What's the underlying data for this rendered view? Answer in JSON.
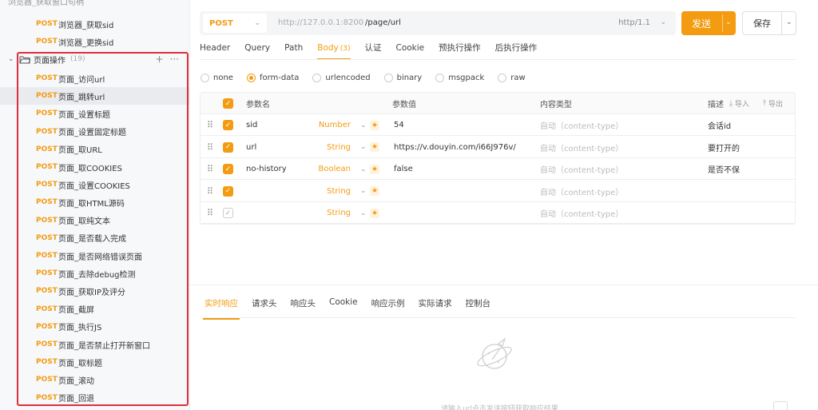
{
  "sidebar": {
    "top_cut_text": "浏览器_获取窗口句柄",
    "pre_items": [
      {
        "method": "POST",
        "name": "浏览器_获取sid"
      },
      {
        "method": "POST",
        "name": "浏览器_更换sid"
      }
    ],
    "folder": {
      "label": "页面操作",
      "count": "(19)",
      "add": "+",
      "more": "···"
    },
    "items": [
      {
        "method": "POST",
        "name": "页面_访问url"
      },
      {
        "method": "POST",
        "name": "页面_跳转url"
      },
      {
        "method": "POST",
        "name": "页面_设置标题"
      },
      {
        "method": "POST",
        "name": "页面_设置固定标题"
      },
      {
        "method": "POST",
        "name": "页面_取URL"
      },
      {
        "method": "POST",
        "name": "页面_取COOKIES"
      },
      {
        "method": "POST",
        "name": "页面_设置COOKIES"
      },
      {
        "method": "POST",
        "name": "页面_取HTML源码"
      },
      {
        "method": "POST",
        "name": "页面_取纯文本"
      },
      {
        "method": "POST",
        "name": "页面_是否载入完成"
      },
      {
        "method": "POST",
        "name": "页面_是否网络错误页面"
      },
      {
        "method": "POST",
        "name": "页面_去除debug检测"
      },
      {
        "method": "POST",
        "name": "页面_获取IP及评分"
      },
      {
        "method": "POST",
        "name": "页面_截屏"
      },
      {
        "method": "POST",
        "name": "页面_执行JS"
      },
      {
        "method": "POST",
        "name": "页面_是否禁止打开新窗口"
      },
      {
        "method": "POST",
        "name": "页面_取标题"
      },
      {
        "method": "POST",
        "name": "页面_滚动"
      },
      {
        "method": "POST",
        "name": "页面_回退"
      }
    ]
  },
  "request": {
    "method": "POST",
    "host": "http://127.0.0.1:8200",
    "path": "/page/url",
    "protocol": "http/1.1",
    "send_label": "发送",
    "save_label": "保存"
  },
  "tabs": {
    "header": "Header",
    "query": "Query",
    "path": "Path",
    "body": "Body",
    "body_count": "(3)",
    "auth": "认证",
    "cookie": "Cookie",
    "pre": "预执行操作",
    "post": "后执行操作"
  },
  "body_types": [
    "none",
    "form-data",
    "urlencoded",
    "binary",
    "msgpack",
    "raw"
  ],
  "params": {
    "headers": {
      "name": "参数名",
      "value": "参数值",
      "content_type": "内容类型",
      "desc": "描述",
      "import": "导入",
      "export": "导出"
    },
    "rows": [
      {
        "name": "sid",
        "type": "Number",
        "value": "54",
        "content_type": "自动（content-type）",
        "desc": "会话id",
        "checked": true
      },
      {
        "name": "url",
        "type": "String",
        "value": "https://v.douyin.com/i66J976v/",
        "content_type": "自动（content-type）",
        "desc": "要打开的",
        "checked": true
      },
      {
        "name": "no-history",
        "type": "Boolean",
        "value": "false",
        "content_type": "自动（content-type）",
        "desc": "是否不保",
        "checked": true
      },
      {
        "name": "",
        "type": "String",
        "value": "",
        "content_type": "自动（content-type）",
        "desc": "",
        "checked": true
      },
      {
        "name": "",
        "type": "String",
        "value": "",
        "content_type": "自动（content-type）",
        "desc": "",
        "checked": false
      }
    ]
  },
  "response_tabs": [
    "实时响应",
    "请求头",
    "响应头",
    "Cookie",
    "响应示例",
    "实际请求",
    "控制台"
  ],
  "response_hint": "请输入url点击发送按钮获取响应结果",
  "colors": {
    "accent": "#f39c12",
    "highlight_box": "#e02d3c"
  }
}
